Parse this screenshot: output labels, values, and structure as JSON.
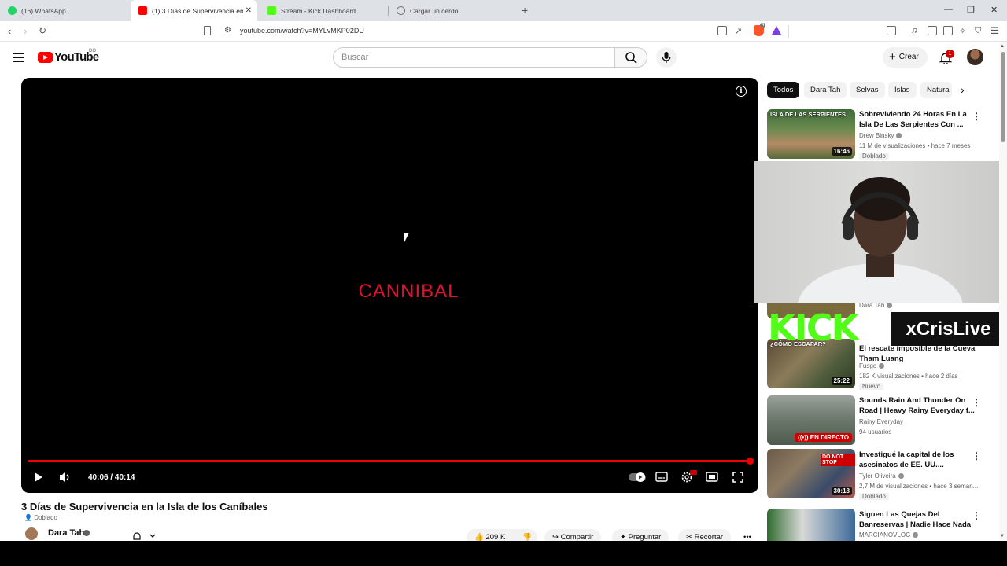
{
  "browser": {
    "tabs": [
      {
        "title": "(16) WhatsApp",
        "favicon_color": "#25d366"
      },
      {
        "title": "(1) 3 Días de Supervivencia en la",
        "favicon_color": "#ff0000"
      },
      {
        "title": "Stream - Kick Dashboard",
        "favicon_color": "#53fc18"
      },
      {
        "title": "Cargar un cerdo",
        "favicon_color": "#777777"
      }
    ],
    "url": "youtube.com/watch?v=MYLvMKP02DU",
    "brave_count": "4"
  },
  "youtube": {
    "logo_text": "YouTube",
    "region": "DO",
    "search_placeholder": "Buscar",
    "create_label": "Crear",
    "notification_count": "1"
  },
  "player": {
    "title_card": "CANNIBAL",
    "time": "40:06 / 40:14",
    "progress": 0.997
  },
  "video": {
    "title": "3 Días de Supervivencia en la Isla de los Caníbales",
    "dub_tag": "Doblado",
    "channel": "Dara Tah",
    "likes": "209 K",
    "share_label": "Compartir",
    "ask_label": "Preguntar",
    "clip_label": "Recortar"
  },
  "chips": [
    "Todos",
    "Dara Tah",
    "Selvas",
    "Islas",
    "Natura"
  ],
  "recommendations": [
    {
      "title": "Sobreviviendo 24 Horas En La Isla De Las Serpientes Con ...",
      "channel": "Drew Binsky",
      "meta": "11 M de visualizaciones • hace 7 meses",
      "badge": "Doblado",
      "duration": "16:46",
      "thumb_text": "ISLA DE LAS SERPIENTES"
    },
    {
      "title": "",
      "channel": "Dara Tah",
      "meta": "",
      "badge": "",
      "duration": ""
    },
    {
      "title": "El rescate imposible de la Cueva Tham Luang",
      "channel": "Fusgo",
      "meta": "182 K visualizaciones • hace 2 días",
      "badge": "Nuevo",
      "duration": "25:22",
      "thumb_text": "¿CÓMO ESCAPAR?"
    },
    {
      "title": "Sounds Rain And Thunder On Road | Heavy Rainy Everyday f...",
      "channel": "Rainy Everyday",
      "meta": "94 usuarios",
      "badge": "",
      "live_label": "EN DIRECTO"
    },
    {
      "title": "Investigué la capital de los asesinatos de EE. UU....",
      "channel": "Tyler Oliveira",
      "meta": "2,7 M de visualizaciones • hace 3 seman...",
      "badge": "Doblado",
      "duration": "30:18",
      "thumb_text": "DO NOT STOP"
    },
    {
      "title": "Siguen Las Quejas Del Banreservas | Nadie Hace Nada",
      "channel": "MARCIANOVLOG",
      "meta": "",
      "badge": "",
      "duration": ""
    }
  ],
  "overlay": {
    "kick_logo": "KICK",
    "streamer": "xCrisLive"
  }
}
